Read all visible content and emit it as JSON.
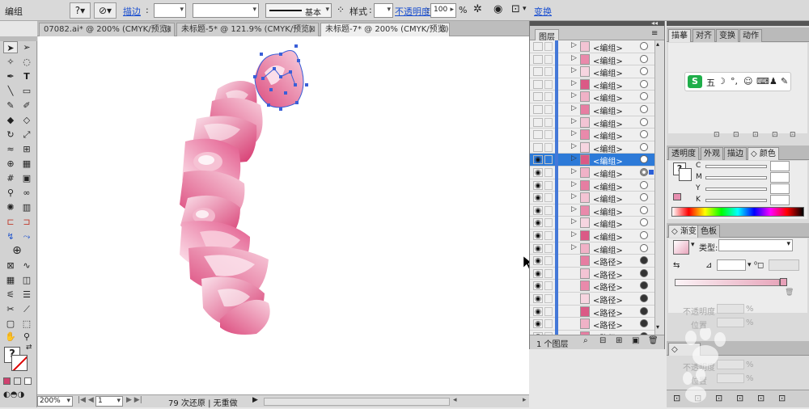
{
  "control_bar": {
    "selection_label": "编组",
    "stroke_label": "描边",
    "stroke_profile": "基本",
    "style_label": "样式",
    "opacity_label": "不透明度",
    "opacity_value": "100",
    "opacity_unit": "%",
    "transform_label": "变换"
  },
  "doc_tabs": [
    {
      "title": "07082.ai* @ 200% (CMYK/预览)"
    },
    {
      "title": "未标题-5* @ 121.9% (CMYK/预览)"
    },
    {
      "title": "未标题-7* @ 200% (CMYK/预览)"
    }
  ],
  "status_bar": {
    "zoom": "200%",
    "artboard": "1",
    "message": "79 次还原 | 无重做"
  },
  "layers_panel": {
    "title": "图层",
    "footer": "1 个图层",
    "rows": [
      {
        "name": "<编组>",
        "visible": false,
        "selected": false,
        "target": "o"
      },
      {
        "name": "<编组>",
        "visible": false,
        "selected": false,
        "target": "o"
      },
      {
        "name": "<编组>",
        "visible": false,
        "selected": false,
        "target": "o"
      },
      {
        "name": "<编组>",
        "visible": false,
        "selected": false,
        "target": "o"
      },
      {
        "name": "<编组>",
        "visible": false,
        "selected": false,
        "target": "o"
      },
      {
        "name": "<编组>",
        "visible": false,
        "selected": false,
        "target": "o"
      },
      {
        "name": "<编组>",
        "visible": false,
        "selected": false,
        "target": "o"
      },
      {
        "name": "<编组>",
        "visible": false,
        "selected": false,
        "target": "o"
      },
      {
        "name": "<编组>",
        "visible": false,
        "selected": false,
        "target": "o"
      },
      {
        "name": "<编组>",
        "visible": true,
        "selected": true,
        "target": "o"
      },
      {
        "name": "<编组>",
        "visible": true,
        "selected": false,
        "target": "sel"
      },
      {
        "name": "<编组>",
        "visible": true,
        "selected": false,
        "target": "o"
      },
      {
        "name": "<编组>",
        "visible": true,
        "selected": false,
        "target": "o"
      },
      {
        "name": "<编组>",
        "visible": true,
        "selected": false,
        "target": "o"
      },
      {
        "name": "<编组>",
        "visible": true,
        "selected": false,
        "target": "o"
      },
      {
        "name": "<编组>",
        "visible": true,
        "selected": false,
        "target": "o"
      },
      {
        "name": "<编组>",
        "visible": true,
        "selected": false,
        "target": "o"
      },
      {
        "name": "<路径>",
        "visible": true,
        "selected": false,
        "target": "f"
      },
      {
        "name": "<路径>",
        "visible": true,
        "selected": false,
        "target": "f"
      },
      {
        "name": "<路径>",
        "visible": true,
        "selected": false,
        "target": "f"
      },
      {
        "name": "<路径>",
        "visible": true,
        "selected": false,
        "target": "f"
      },
      {
        "name": "<路径>",
        "visible": true,
        "selected": false,
        "target": "f"
      },
      {
        "name": "<路径>",
        "visible": true,
        "selected": false,
        "target": "f"
      },
      {
        "name": "<路径>",
        "visible": true,
        "selected": false,
        "target": "f"
      }
    ]
  },
  "top_right_panel": {
    "tabs": [
      "描摹",
      "对齐",
      "变换",
      "动作"
    ]
  },
  "ime_toolbar": {
    "label": "五"
  },
  "color_panel": {
    "tabs": [
      "透明度",
      "外观",
      "描边",
      "颜色"
    ],
    "channels": [
      "C",
      "M",
      "Y",
      "K"
    ]
  },
  "gradient_panel": {
    "tabs": [
      "渐变",
      "色板"
    ],
    "type_label": "类型:",
    "opacity_label": "不透明度",
    "location_label": "位置",
    "percent": "%"
  },
  "bottom_panel": {
    "opacity_label": "不透明度",
    "location_label": "位置",
    "percent": "%"
  },
  "colors": {
    "accent": "#2d7ad8",
    "rose_dark": "#d13a6f",
    "rose_light": "#f7d6e1",
    "selection": "#3a5fd8"
  }
}
